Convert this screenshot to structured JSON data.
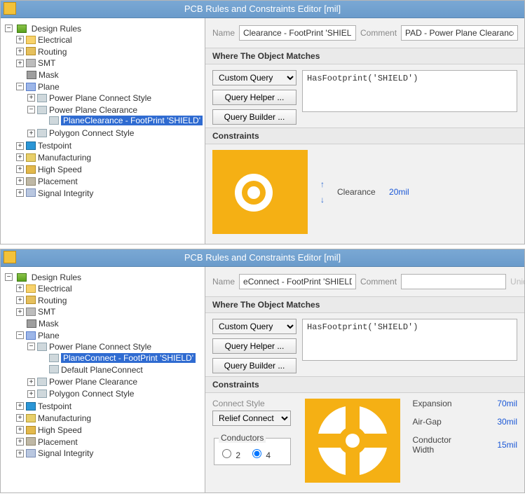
{
  "dialogTitle": "PCB Rules and Constraints Editor [mil]",
  "tree": {
    "root": "Design Rules",
    "electrical": "Electrical",
    "routing": "Routing",
    "smt": "SMT",
    "mask": "Mask",
    "plane": "Plane",
    "ppConnect": "Power Plane Connect Style",
    "ppClearance": "Power Plane Clearance",
    "polyConnect": "Polygon Connect Style",
    "testpoint": "Testpoint",
    "manufacturing": "Manufacturing",
    "highSpeed": "High Speed",
    "placement": "Placement",
    "signalIntegrity": "Signal Integrity",
    "planeClearanceRule": "PlaneClearance - FootPrint 'SHIELD'",
    "planeConnectRule": "PlaneConnect - FootPrint 'SHIELD'",
    "defaultPlaneConnect": "Default PlaneConnect"
  },
  "top": {
    "nameLabel": "Name",
    "nameVal": "Clearance - FootPrint 'SHIELD'",
    "commentLabel": "Comment",
    "commentVal": "PAD - Power Plane Clearance",
    "whereHeader": "Where The Object Matches",
    "queryType": "Custom Query",
    "queryHelper": "Query Helper ...",
    "queryBuilder": "Query Builder ...",
    "queryText": "HasFootprint('SHIELD')",
    "constraintsHeader": "Constraints",
    "clearanceLabel": "Clearance",
    "clearanceVal": "20mil"
  },
  "bottom": {
    "nameLabel": "Name",
    "nameVal": "eConnect - FootPrint 'SHIELD'",
    "commentLabel": "Comment",
    "commentVal": "",
    "uniqueHint": "Uniqu",
    "whereHeader": "Where The Object Matches",
    "queryType": "Custom Query",
    "queryHelper": "Query Helper ...",
    "queryBuilder": "Query Builder ...",
    "queryText": "HasFootprint('SHIELD')",
    "constraintsHeader": "Constraints",
    "connectStyleLabel": "Connect Style",
    "connectStyleVal": "Relief Connect",
    "conductorsLabel": "Conductors",
    "opt2": "2",
    "opt4": "4",
    "optSelected": "4",
    "expansionLabel": "Expansion",
    "expansionVal": "70mil",
    "airGapLabel": "Air-Gap",
    "airGapVal": "30mil",
    "conductorWidthLabel": "Conductor Width",
    "conductorWidthVal": "15mil"
  }
}
